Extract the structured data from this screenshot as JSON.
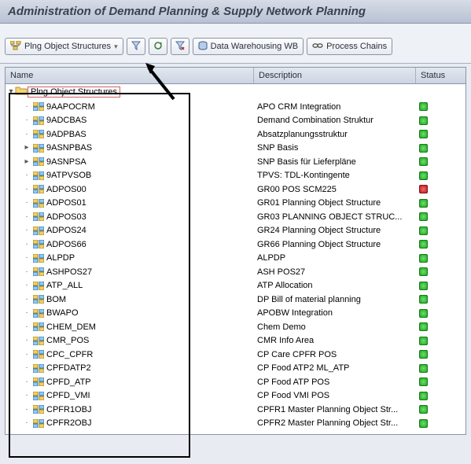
{
  "title": "Administration of Demand Planning & Supply Network Planning",
  "toolbar": {
    "plng_structures": "Plng Object Structures",
    "data_wb": "Data Warehousing WB",
    "process_chains": "Process Chains"
  },
  "grid": {
    "headers": {
      "name": "Name",
      "desc": "Description",
      "status": "Status"
    },
    "root": "Plng Object Structures",
    "rows": [
      {
        "exp": "·",
        "name": "9AAPOCRM",
        "desc": "APO CRM Integration",
        "status": "green"
      },
      {
        "exp": "·",
        "name": "9ADCBAS",
        "desc": "Demand Combination Struktur",
        "status": "green"
      },
      {
        "exp": "·",
        "name": "9ADPBAS",
        "desc": "Absatzplanungsstruktur",
        "status": "green"
      },
      {
        "exp": "▸",
        "name": "9ASNPBAS",
        "desc": "SNP Basis",
        "status": "green"
      },
      {
        "exp": "▸",
        "name": "9ASNPSA",
        "desc": "SNP Basis für Lieferpläne",
        "status": "green"
      },
      {
        "exp": "·",
        "name": "9ATPVSOB",
        "desc": "TPVS: TDL-Kontingente",
        "status": "green"
      },
      {
        "exp": "·",
        "name": "ADPOS00",
        "desc": "GR00 POS SCM225",
        "status": "red"
      },
      {
        "exp": "·",
        "name": "ADPOS01",
        "desc": "GR01 Planning Object Structure",
        "status": "green"
      },
      {
        "exp": "·",
        "name": "ADPOS03",
        "desc": "GR03 PLANNING OBJECT STRUC...",
        "status": "green"
      },
      {
        "exp": "·",
        "name": "ADPOS24",
        "desc": "GR24 Planning Object Structure",
        "status": "green"
      },
      {
        "exp": "·",
        "name": "ADPOS66",
        "desc": "GR66 Planning Object Structure",
        "status": "green"
      },
      {
        "exp": "·",
        "name": "ALPDP",
        "desc": "ALPDP",
        "status": "green"
      },
      {
        "exp": "·",
        "name": "ASHPOS27",
        "desc": "ASH POS27",
        "status": "green"
      },
      {
        "exp": "·",
        "name": "ATP_ALL",
        "desc": "ATP Allocation",
        "status": "green"
      },
      {
        "exp": "·",
        "name": "BOM",
        "desc": "DP Bill of material planning",
        "status": "green"
      },
      {
        "exp": "·",
        "name": "BWAPO",
        "desc": "APOBW Integration",
        "status": "green"
      },
      {
        "exp": "·",
        "name": "CHEM_DEM",
        "desc": "Chem Demo",
        "status": "green"
      },
      {
        "exp": "·",
        "name": "CMR_POS",
        "desc": "CMR Info Area",
        "status": "green"
      },
      {
        "exp": "·",
        "name": "CPC_CPFR",
        "desc": "CP Care CPFR POS",
        "status": "green"
      },
      {
        "exp": "·",
        "name": "CPFDATP2",
        "desc": "CP Food ATP2 ML_ATP",
        "status": "green"
      },
      {
        "exp": "·",
        "name": "CPFD_ATP",
        "desc": "CP Food ATP POS",
        "status": "green"
      },
      {
        "exp": "·",
        "name": "CPFD_VMI",
        "desc": "CP Food VMI POS",
        "status": "green"
      },
      {
        "exp": "·",
        "name": "CPFR1OBJ",
        "desc": "CPFR1 Master Planning Object Str...",
        "status": "green"
      },
      {
        "exp": "·",
        "name": "CPFR2OBJ",
        "desc": "CPFR2 Master Planning Object Str...",
        "status": "green"
      }
    ]
  }
}
